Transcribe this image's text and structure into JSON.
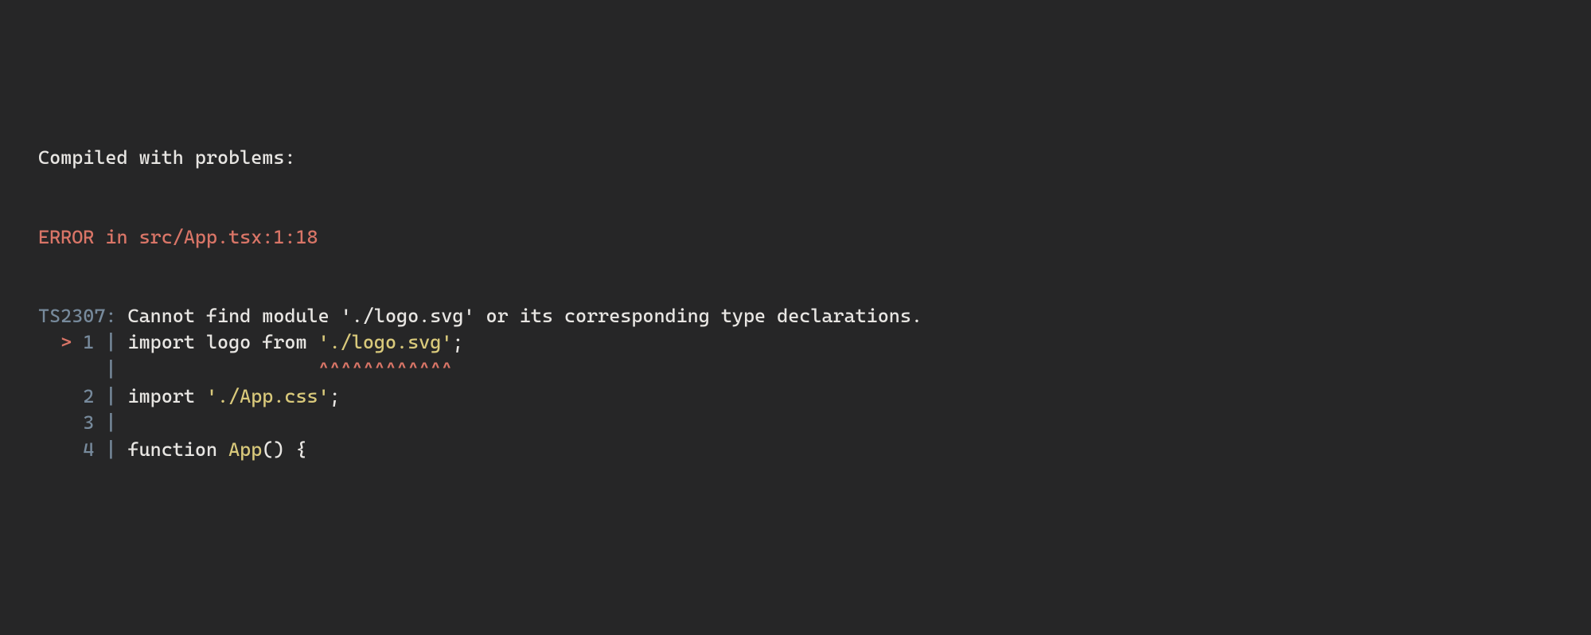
{
  "header": "Compiled with problems:",
  "error_prefix": "ERROR in ",
  "error_location": "src/App.tsx:1:18",
  "ts_code": "TS2307:",
  "ts_message": " Cannot find module './logo.svg' or its corresponding type declarations.",
  "lines": {
    "l1": {
      "caret": "  > ",
      "num": "1",
      "pipe": " | ",
      "kw1": "import",
      "sp1": " ",
      "ident": "logo",
      "sp2": " ",
      "kw2": "from",
      "sp3": " ",
      "str": "'./logo.svg'",
      "punct": ";"
    },
    "l1u": {
      "pad": "      ",
      "pipe": "| ",
      "spaces": "                 ",
      "underline": "^^^^^^^^^^^^"
    },
    "l2": {
      "pad": "    ",
      "num": "2",
      "pipe": " | ",
      "kw": "import",
      "sp": " ",
      "str": "'./App.css'",
      "punct": ";"
    },
    "l3": {
      "pad": "    ",
      "num": "3",
      "pipe": " |"
    },
    "l4": {
      "pad": "    ",
      "num": "4",
      "pipe": " | ",
      "kw": "function",
      "sp": " ",
      "fn": "App",
      "paren": "()",
      "sp2": " ",
      "brace": "{"
    }
  }
}
